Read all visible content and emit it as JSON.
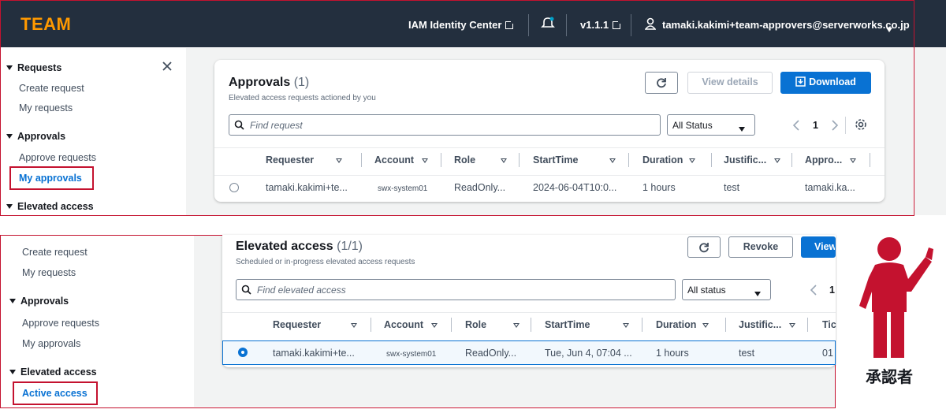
{
  "topbar": {
    "brand": "TEAM",
    "identity_center": "IAM Identity Center",
    "version": "v1.1.1",
    "user": "tamaki.kakimi+team-approvers@serverworks.co.jp"
  },
  "top_panel": {
    "sidebar": {
      "requests_header": "Requests",
      "create_request": "Create request",
      "my_requests": "My requests",
      "approvals_header": "Approvals",
      "approve_requests": "Approve requests",
      "my_approvals": "My approvals",
      "elevated_header": "Elevated access"
    },
    "card": {
      "title": "Approvals",
      "count": "(1)",
      "subtitle": "Elevated access requests actioned by you",
      "view_details": "View details",
      "download": "Download",
      "search_placeholder": "Find request",
      "status_filter": "All Status",
      "page": "1",
      "columns": [
        "Requester",
        "Account",
        "Role",
        "StartTime",
        "Duration",
        "Justific...",
        "Appro..."
      ],
      "row": [
        "tamaki.kakimi+te...",
        "swx-system01",
        "ReadOnly...",
        "2024-06-04T10:0...",
        "1 hours",
        "test",
        "tamaki.ka..."
      ]
    }
  },
  "bottom_panel": {
    "sidebar": {
      "create_request": "Create request",
      "my_requests": "My requests",
      "approvals_header": "Approvals",
      "approve_requests": "Approve requests",
      "my_approvals": "My approvals",
      "elevated_header": "Elevated access",
      "active_access": "Active access"
    },
    "card": {
      "title": "Elevated access",
      "count": "(1/1)",
      "subtitle": "Scheduled or in-progress elevated access requests",
      "revoke": "Revoke",
      "view": "View",
      "search_placeholder": "Find elevated access",
      "status_filter": "All status",
      "page": "1",
      "columns": [
        "Requester",
        "Account",
        "Role",
        "StartTime",
        "Duration",
        "Justific...",
        "Tic"
      ],
      "row": [
        "tamaki.kakimi+te...",
        "swx-system01",
        "ReadOnly...",
        "Tue, Jun 4, 07:04 ...",
        "1 hours",
        "test",
        "01"
      ]
    }
  },
  "overlay": {
    "approver_label": "承認者",
    "figure_color": "#c4122f"
  },
  "colors": {
    "accent": "#0972d3",
    "brand": "#ff9900",
    "highlight": "#c4122f",
    "topbar": "#232f3e"
  }
}
